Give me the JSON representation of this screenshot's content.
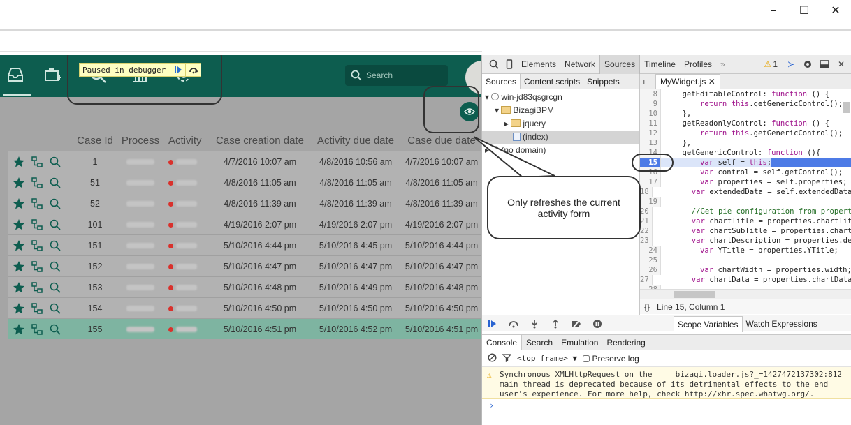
{
  "window": {
    "minimize": "–",
    "maximize": "☐",
    "close": "✕"
  },
  "app": {
    "paused_label": "Paused in debugger",
    "search_placeholder": "Search",
    "table": {
      "headers": [
        "Case Id",
        "Process",
        "Activity",
        "Case creation date",
        "Activity due date",
        "Case due date"
      ],
      "rows": [
        {
          "id": "1",
          "creation": "4/7/2016 10:07 am",
          "activity_due": "4/8/2016 10:56 am",
          "case_due": "4/7/2016 10:07 am"
        },
        {
          "id": "51",
          "creation": "4/8/2016 11:05 am",
          "activity_due": "4/8/2016 11:05 am",
          "case_due": "4/8/2016 11:05 am"
        },
        {
          "id": "52",
          "creation": "4/8/2016 11:39 am",
          "activity_due": "4/8/2016 11:39 am",
          "case_due": "4/8/2016 11:39 am"
        },
        {
          "id": "101",
          "creation": "4/19/2016 2:07 pm",
          "activity_due": "4/19/2016 2:07 pm",
          "case_due": "4/19/2016 2:07 pm"
        },
        {
          "id": "151",
          "creation": "5/10/2016 4:44 pm",
          "activity_due": "5/10/2016 4:45 pm",
          "case_due": "5/10/2016 4:44 pm"
        },
        {
          "id": "152",
          "creation": "5/10/2016 4:47 pm",
          "activity_due": "5/10/2016 4:47 pm",
          "case_due": "5/10/2016 4:47 pm"
        },
        {
          "id": "153",
          "creation": "5/10/2016 4:48 pm",
          "activity_due": "5/10/2016 4:49 pm",
          "case_due": "5/10/2016 4:48 pm"
        },
        {
          "id": "154",
          "creation": "5/10/2016 4:50 pm",
          "activity_due": "5/10/2016 4:50 pm",
          "case_due": "5/10/2016 4:50 pm"
        },
        {
          "id": "155",
          "creation": "5/10/2016 4:51 pm",
          "activity_due": "5/10/2016 4:52 pm",
          "case_due": "5/10/2016 4:51 pm"
        }
      ]
    }
  },
  "devtools": {
    "tabs": [
      "Elements",
      "Network",
      "Sources",
      "Timeline",
      "Profiles",
      "»"
    ],
    "warning_count": "1",
    "navigator": {
      "tabs": [
        "Sources",
        "Content scripts",
        "Snippets"
      ],
      "tree": [
        "win-jd83qsgrcgn",
        "BizagiBPM",
        "jquery",
        "(index)",
        "(no domain)"
      ]
    },
    "editor": {
      "file_tab": "MyWidget.js",
      "status": "Line 15, Column 1",
      "lines": [
        {
          "n": "8",
          "t": "    getEditableControl: function () {"
        },
        {
          "n": "9",
          "t": "        return this.getGenericControl();"
        },
        {
          "n": "10",
          "t": "    },"
        },
        {
          "n": "11",
          "t": "    getReadonlyControl: function () {"
        },
        {
          "n": "12",
          "t": "        return this.getGenericControl();"
        },
        {
          "n": "13",
          "t": "    },"
        },
        {
          "n": "14",
          "t": "    getGenericControl: function (){"
        },
        {
          "n": "15",
          "t": "        var self = this;"
        },
        {
          "n": "16",
          "t": "        var control = self.getControl();"
        },
        {
          "n": "17",
          "t": "        var properties = self.properties;"
        },
        {
          "n": "18",
          "t": "        var extendedData = self.extendedData;"
        },
        {
          "n": "19",
          "t": ""
        },
        {
          "n": "20",
          "t": "        //Get pie configuration from properties"
        },
        {
          "n": "21",
          "t": "        var chartTitle = properties.chartTitle;"
        },
        {
          "n": "22",
          "t": "        var chartSubTitle = properties.chartSubTitle;"
        },
        {
          "n": "23",
          "t": "        var chartDescription = properties.description;"
        },
        {
          "n": "24",
          "t": "        var YTitle = properties.YTitle;"
        },
        {
          "n": "25",
          "t": ""
        },
        {
          "n": "26",
          "t": "        var chartWidth = properties.width;"
        },
        {
          "n": "27",
          "t": "        var chartData = properties.chartData;"
        },
        {
          "n": "28",
          "t": ""
        }
      ],
      "highlight_line": "15"
    },
    "scope_tabs": [
      "Scope Variables",
      "Watch Expressions"
    ],
    "drawer_tabs": [
      "Console",
      "Search",
      "Emulation",
      "Rendering"
    ],
    "console": {
      "frame": "<top frame>",
      "preserve_log": "Preserve log",
      "warning_text_1": "Synchronous XMLHttpRequest on the",
      "warning_text_2": "main thread is deprecated because of its detrimental effects to the end",
      "warning_text_3": "user's experience. For more help, check http://xhr.spec.whatwg.org/.",
      "warning_link": "bizagi.loader.js?_=1427472137302:812",
      "prompt": "›"
    }
  },
  "annotation": {
    "bubble_text": "Only refreshes the current activity form"
  }
}
